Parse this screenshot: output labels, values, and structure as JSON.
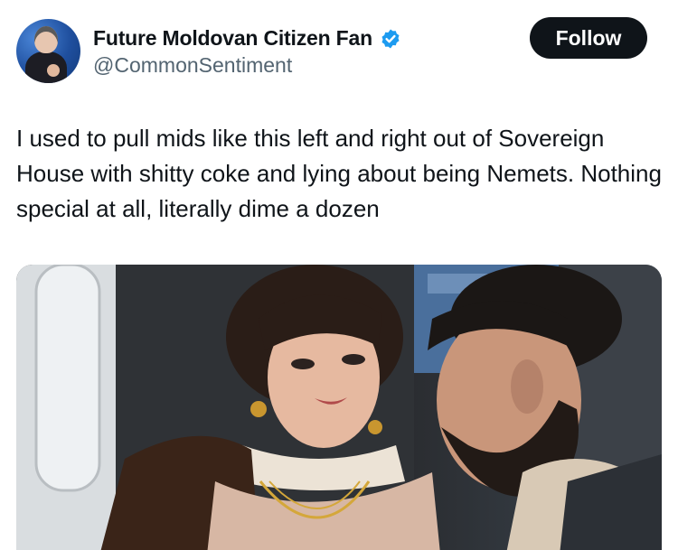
{
  "author": {
    "display_name": "Future Moldovan Citizen Fan",
    "handle": "@CommonSentiment",
    "verified_icon": "verified-badge-icon",
    "verified_color": "#1d9bf0"
  },
  "actions": {
    "follow_label": "Follow"
  },
  "tweet": {
    "text": "I used to pull mids like this left and right out of Sovereign House with shitty coke and lying about being Nemets. Nothing special at all, literally dime a dozen"
  },
  "media": {
    "type": "photo"
  },
  "colors": {
    "text": "#0f1419",
    "secondary": "#536471",
    "button_bg": "#0f1419",
    "button_text": "#ffffff"
  }
}
